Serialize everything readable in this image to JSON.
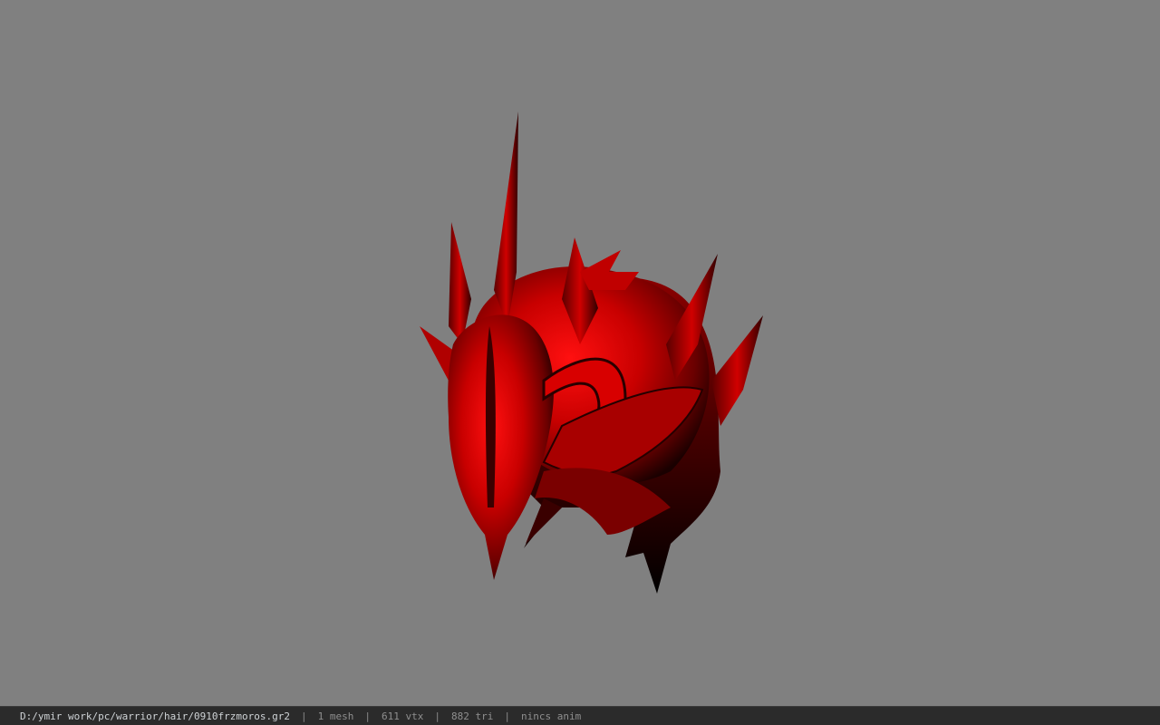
{
  "viewer": {
    "background_color": "#808080",
    "model_color": "#d40000",
    "model_shadow_color": "#1a0000"
  },
  "statusbar": {
    "file_path": "D:/ymir work/pc/warrior/hair/0910frzmoros.gr2",
    "separator": "|",
    "mesh_count": "1 mesh",
    "vertex_count": "611 vtx",
    "triangle_count": "882 tri",
    "anim_status": "nincs anim"
  }
}
